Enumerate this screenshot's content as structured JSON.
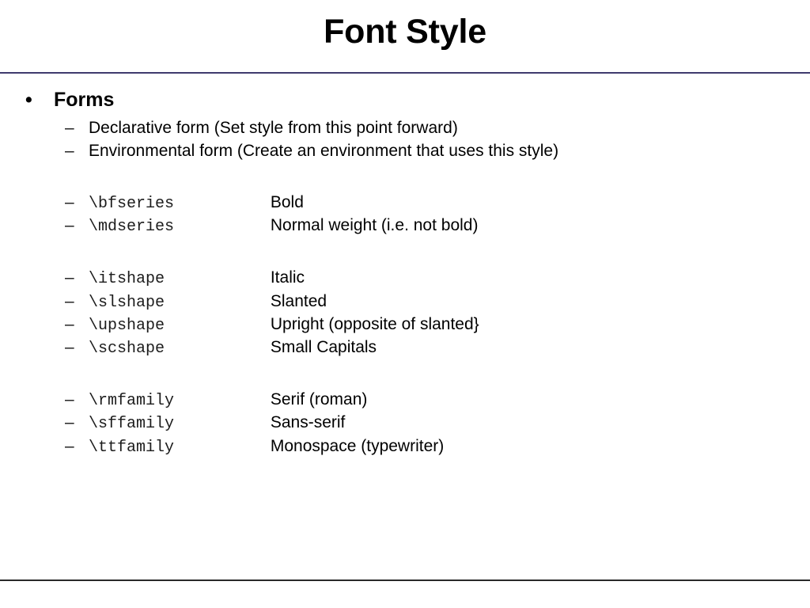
{
  "slide": {
    "title": "Font Style",
    "title_rule_color": "#3F3A6E",
    "bottom_rule_color": "#2A2A2A",
    "background_color": "#FFFFFF",
    "text_color": "#000000"
  },
  "content": {
    "bullet_glyph": "•",
    "dash_glyph": "–",
    "heading": "Forms",
    "forms": [
      {
        "text": "Declarative form (Set style from this point forward)"
      },
      {
        "text": "Environmental form (Create an environment that uses this style)"
      }
    ],
    "groups": [
      {
        "name": "series",
        "rows": [
          {
            "command": "\\bfseries",
            "description": "Bold"
          },
          {
            "command": "\\mdseries",
            "description": "Normal weight (i.e. not bold)"
          }
        ]
      },
      {
        "name": "shape",
        "rows": [
          {
            "command": "\\itshape",
            "description": "Italic"
          },
          {
            "command": "\\slshape",
            "description": "Slanted"
          },
          {
            "command": "\\upshape",
            "description": "Upright (opposite of slanted}"
          },
          {
            "command": "\\scshape",
            "description": "Small Capitals"
          }
        ]
      },
      {
        "name": "family",
        "rows": [
          {
            "command": "\\rmfamily",
            "description": "Serif (roman)"
          },
          {
            "command": "\\sffamily",
            "description": "Sans-serif"
          },
          {
            "command": "\\ttfamily",
            "description": "Monospace (typewriter)"
          }
        ]
      }
    ]
  }
}
